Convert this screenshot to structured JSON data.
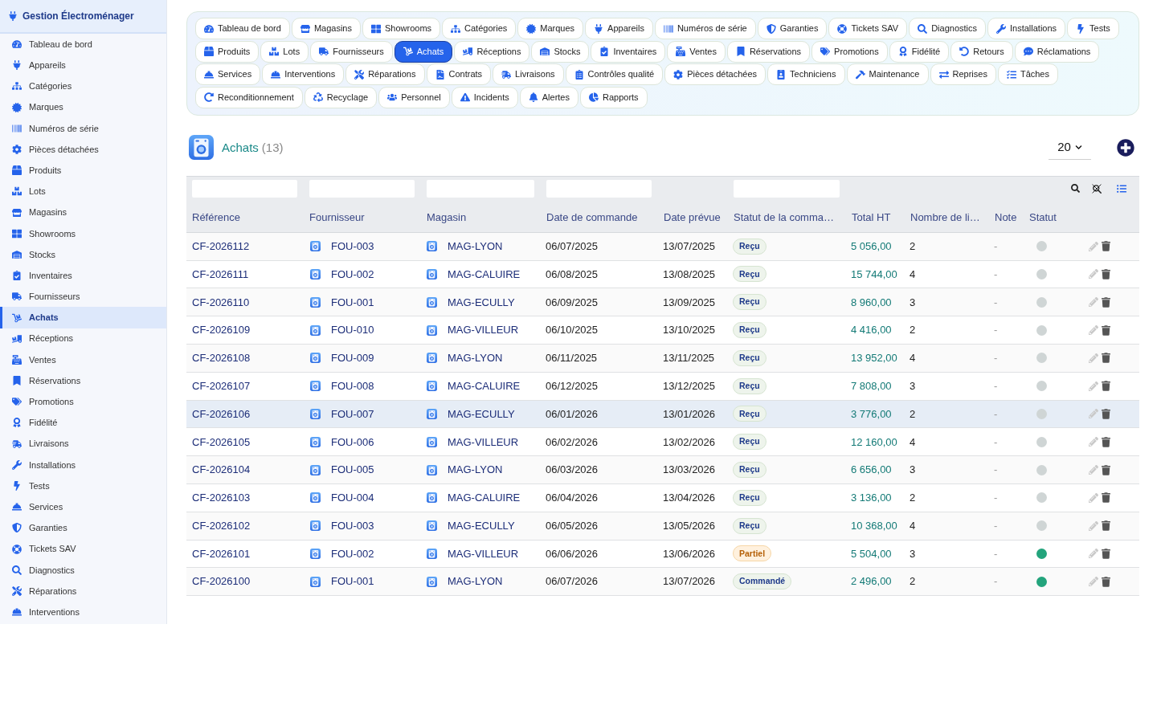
{
  "sidebar": {
    "title": "Gestion Électroménager",
    "items": [
      {
        "label": "Tableau de bord",
        "selected": false
      },
      {
        "label": "Appareils",
        "selected": false
      },
      {
        "label": "Catégories",
        "selected": false
      },
      {
        "label": "Marques",
        "selected": false
      },
      {
        "label": "Numéros de série",
        "selected": false
      },
      {
        "label": "Pièces détachées",
        "selected": false
      },
      {
        "label": "Produits",
        "selected": false
      },
      {
        "label": "Lots",
        "selected": false
      },
      {
        "label": "Magasins",
        "selected": false
      },
      {
        "label": "Showrooms",
        "selected": false
      },
      {
        "label": "Stocks",
        "selected": false
      },
      {
        "label": "Inventaires",
        "selected": false
      },
      {
        "label": "Fournisseurs",
        "selected": false
      },
      {
        "label": "Achats",
        "selected": true
      },
      {
        "label": "Réceptions",
        "selected": false
      },
      {
        "label": "Ventes",
        "selected": false
      },
      {
        "label": "Réservations",
        "selected": false
      },
      {
        "label": "Promotions",
        "selected": false
      },
      {
        "label": "Fidélité",
        "selected": false
      },
      {
        "label": "Livraisons",
        "selected": false
      },
      {
        "label": "Installations",
        "selected": false
      },
      {
        "label": "Tests",
        "selected": false
      },
      {
        "label": "Services",
        "selected": false
      },
      {
        "label": "Garanties",
        "selected": false
      },
      {
        "label": "Tickets SAV",
        "selected": false
      },
      {
        "label": "Diagnostics",
        "selected": false
      },
      {
        "label": "Réparations",
        "selected": false
      },
      {
        "label": "Interventions",
        "selected": false
      }
    ]
  },
  "tab_rows": [
    [
      {
        "label": "Tableau de bord",
        "selected": false
      },
      {
        "label": "Magasins",
        "selected": false
      },
      {
        "label": "Showrooms",
        "selected": false
      },
      {
        "label": "Catégories",
        "selected": false
      },
      {
        "label": "Marques",
        "selected": false
      },
      {
        "label": "Appareils",
        "selected": false
      },
      {
        "label": "Numéros de série",
        "selected": false
      },
      {
        "label": "Garanties",
        "selected": false
      },
      {
        "label": "Tickets SAV",
        "selected": false
      },
      {
        "label": "Diagnostics",
        "selected": false
      },
      {
        "label": "Installations",
        "selected": false
      },
      {
        "label": "Tests",
        "selected": false
      }
    ],
    [
      {
        "label": "Produits",
        "selected": false
      },
      {
        "label": "Lots",
        "selected": false
      },
      {
        "label": "Fournisseurs",
        "selected": false
      },
      {
        "label": "Achats",
        "selected": true
      },
      {
        "label": "Réceptions",
        "selected": false
      },
      {
        "label": "Stocks",
        "selected": false
      },
      {
        "label": "Inventaires",
        "selected": false
      },
      {
        "label": "Ventes",
        "selected": false
      },
      {
        "label": "Réservations",
        "selected": false
      },
      {
        "label": "Promotions",
        "selected": false
      },
      {
        "label": "Fidélité",
        "selected": false
      },
      {
        "label": "Retours",
        "selected": false
      },
      {
        "label": "Réclamations",
        "selected": false
      }
    ],
    [
      {
        "label": "Services",
        "selected": false
      },
      {
        "label": "Interventions",
        "selected": false
      },
      {
        "label": "Réparations",
        "selected": false
      },
      {
        "label": "Contrats",
        "selected": false
      },
      {
        "label": "Livraisons",
        "selected": false
      },
      {
        "label": "Contrôles qualité",
        "selected": false
      },
      {
        "label": "Pièces détachées",
        "selected": false
      },
      {
        "label": "Techniciens",
        "selected": false
      },
      {
        "label": "Maintenance",
        "selected": false
      },
      {
        "label": "Reprises",
        "selected": false
      },
      {
        "label": "Tâches",
        "selected": false
      }
    ],
    [
      {
        "label": "Reconditionnement",
        "selected": false
      },
      {
        "label": "Recyclage",
        "selected": false
      },
      {
        "label": "Personnel",
        "selected": false
      },
      {
        "label": "Incidents",
        "selected": false
      },
      {
        "label": "Alertes",
        "selected": false
      },
      {
        "label": "Rapports",
        "selected": false
      }
    ]
  ],
  "header": {
    "title": "Achats",
    "count": "(13)",
    "page_size": "20"
  },
  "table": {
    "columns": [
      {
        "label": "Référence",
        "filter": true
      },
      {
        "label": "Fournisseur",
        "filter": true
      },
      {
        "label": "Magasin",
        "filter": true
      },
      {
        "label": "Date de commande",
        "filter": true
      },
      {
        "label": "Date prévue",
        "filter": false
      },
      {
        "label": "Statut de la comma…",
        "filter": true
      },
      {
        "label": "Total HT",
        "filter": false
      },
      {
        "label": "Nombre de li…",
        "filter": false
      },
      {
        "label": "Note",
        "filter": false
      },
      {
        "label": "Statut",
        "filter": false
      }
    ],
    "rows": [
      {
        "reference": "CF-2026112",
        "supplier": "FOU-003",
        "store": "MAG-LYON",
        "order_date": "06/07/2025",
        "expected_date": "13/07/2025",
        "status": {
          "label": "Reçu",
          "kind": "neutral"
        },
        "total": "5 056,00",
        "lines": "2",
        "note": "-",
        "color": "#cfd5d5",
        "selected": false
      },
      {
        "reference": "CF-2026111",
        "supplier": "FOU-002",
        "store": "MAG-CALUIRE",
        "order_date": "06/08/2025",
        "expected_date": "13/08/2025",
        "status": {
          "label": "Reçu",
          "kind": "neutral"
        },
        "total": "15 744,00",
        "lines": "4",
        "note": "-",
        "color": "#cfd5d5",
        "selected": false
      },
      {
        "reference": "CF-2026110",
        "supplier": "FOU-001",
        "store": "MAG-ECULLY",
        "order_date": "06/09/2025",
        "expected_date": "13/09/2025",
        "status": {
          "label": "Reçu",
          "kind": "neutral"
        },
        "total": "8 960,00",
        "lines": "3",
        "note": "-",
        "color": "#cfd5d5",
        "selected": false
      },
      {
        "reference": "CF-2026109",
        "supplier": "FOU-010",
        "store": "MAG-VILLEUR",
        "order_date": "06/10/2025",
        "expected_date": "13/10/2025",
        "status": {
          "label": "Reçu",
          "kind": "neutral"
        },
        "total": "4 416,00",
        "lines": "2",
        "note": "-",
        "color": "#cfd5d5",
        "selected": false
      },
      {
        "reference": "CF-2026108",
        "supplier": "FOU-009",
        "store": "MAG-LYON",
        "order_date": "06/11/2025",
        "expected_date": "13/11/2025",
        "status": {
          "label": "Reçu",
          "kind": "neutral"
        },
        "total": "13 952,00",
        "lines": "4",
        "note": "-",
        "color": "#cfd5d5",
        "selected": false
      },
      {
        "reference": "CF-2026107",
        "supplier": "FOU-008",
        "store": "MAG-CALUIRE",
        "order_date": "06/12/2025",
        "expected_date": "13/12/2025",
        "status": {
          "label": "Reçu",
          "kind": "neutral"
        },
        "total": "7 808,00",
        "lines": "3",
        "note": "-",
        "color": "#cfd5d5",
        "selected": false
      },
      {
        "reference": "CF-2026106",
        "supplier": "FOU-007",
        "store": "MAG-ECULLY",
        "order_date": "06/01/2026",
        "expected_date": "13/01/2026",
        "status": {
          "label": "Reçu",
          "kind": "neutral"
        },
        "total": "3 776,00",
        "lines": "2",
        "note": "-",
        "color": "#cfd5d5",
        "selected": true
      },
      {
        "reference": "CF-2026105",
        "supplier": "FOU-006",
        "store": "MAG-VILLEUR",
        "order_date": "06/02/2026",
        "expected_date": "13/02/2026",
        "status": {
          "label": "Reçu",
          "kind": "neutral"
        },
        "total": "12 160,00",
        "lines": "4",
        "note": "-",
        "color": "#cfd5d5",
        "selected": false
      },
      {
        "reference": "CF-2026104",
        "supplier": "FOU-005",
        "store": "MAG-LYON",
        "order_date": "06/03/2026",
        "expected_date": "13/03/2026",
        "status": {
          "label": "Reçu",
          "kind": "neutral"
        },
        "total": "6 656,00",
        "lines": "3",
        "note": "-",
        "color": "#cfd5d5",
        "selected": false
      },
      {
        "reference": "CF-2026103",
        "supplier": "FOU-004",
        "store": "MAG-CALUIRE",
        "order_date": "06/04/2026",
        "expected_date": "13/04/2026",
        "status": {
          "label": "Reçu",
          "kind": "neutral"
        },
        "total": "3 136,00",
        "lines": "2",
        "note": "-",
        "color": "#cfd5d5",
        "selected": false
      },
      {
        "reference": "CF-2026102",
        "supplier": "FOU-003",
        "store": "MAG-ECULLY",
        "order_date": "06/05/2026",
        "expected_date": "13/05/2026",
        "status": {
          "label": "Reçu",
          "kind": "neutral"
        },
        "total": "10 368,00",
        "lines": "4",
        "note": "-",
        "color": "#cfd5d5",
        "selected": false
      },
      {
        "reference": "CF-2026101",
        "supplier": "FOU-002",
        "store": "MAG-VILLEUR",
        "order_date": "06/06/2026",
        "expected_date": "13/06/2026",
        "status": {
          "label": "Partiel",
          "kind": "warning"
        },
        "total": "5 504,00",
        "lines": "3",
        "note": "-",
        "color": "#23a47c",
        "selected": false
      },
      {
        "reference": "CF-2026100",
        "supplier": "FOU-001",
        "store": "MAG-LYON",
        "order_date": "06/07/2026",
        "expected_date": "13/07/2026",
        "status": {
          "label": "Commandé",
          "kind": "neutral"
        },
        "total": "2 496,00",
        "lines": "2",
        "note": "-",
        "color": "#23a47c",
        "selected": false
      }
    ]
  }
}
